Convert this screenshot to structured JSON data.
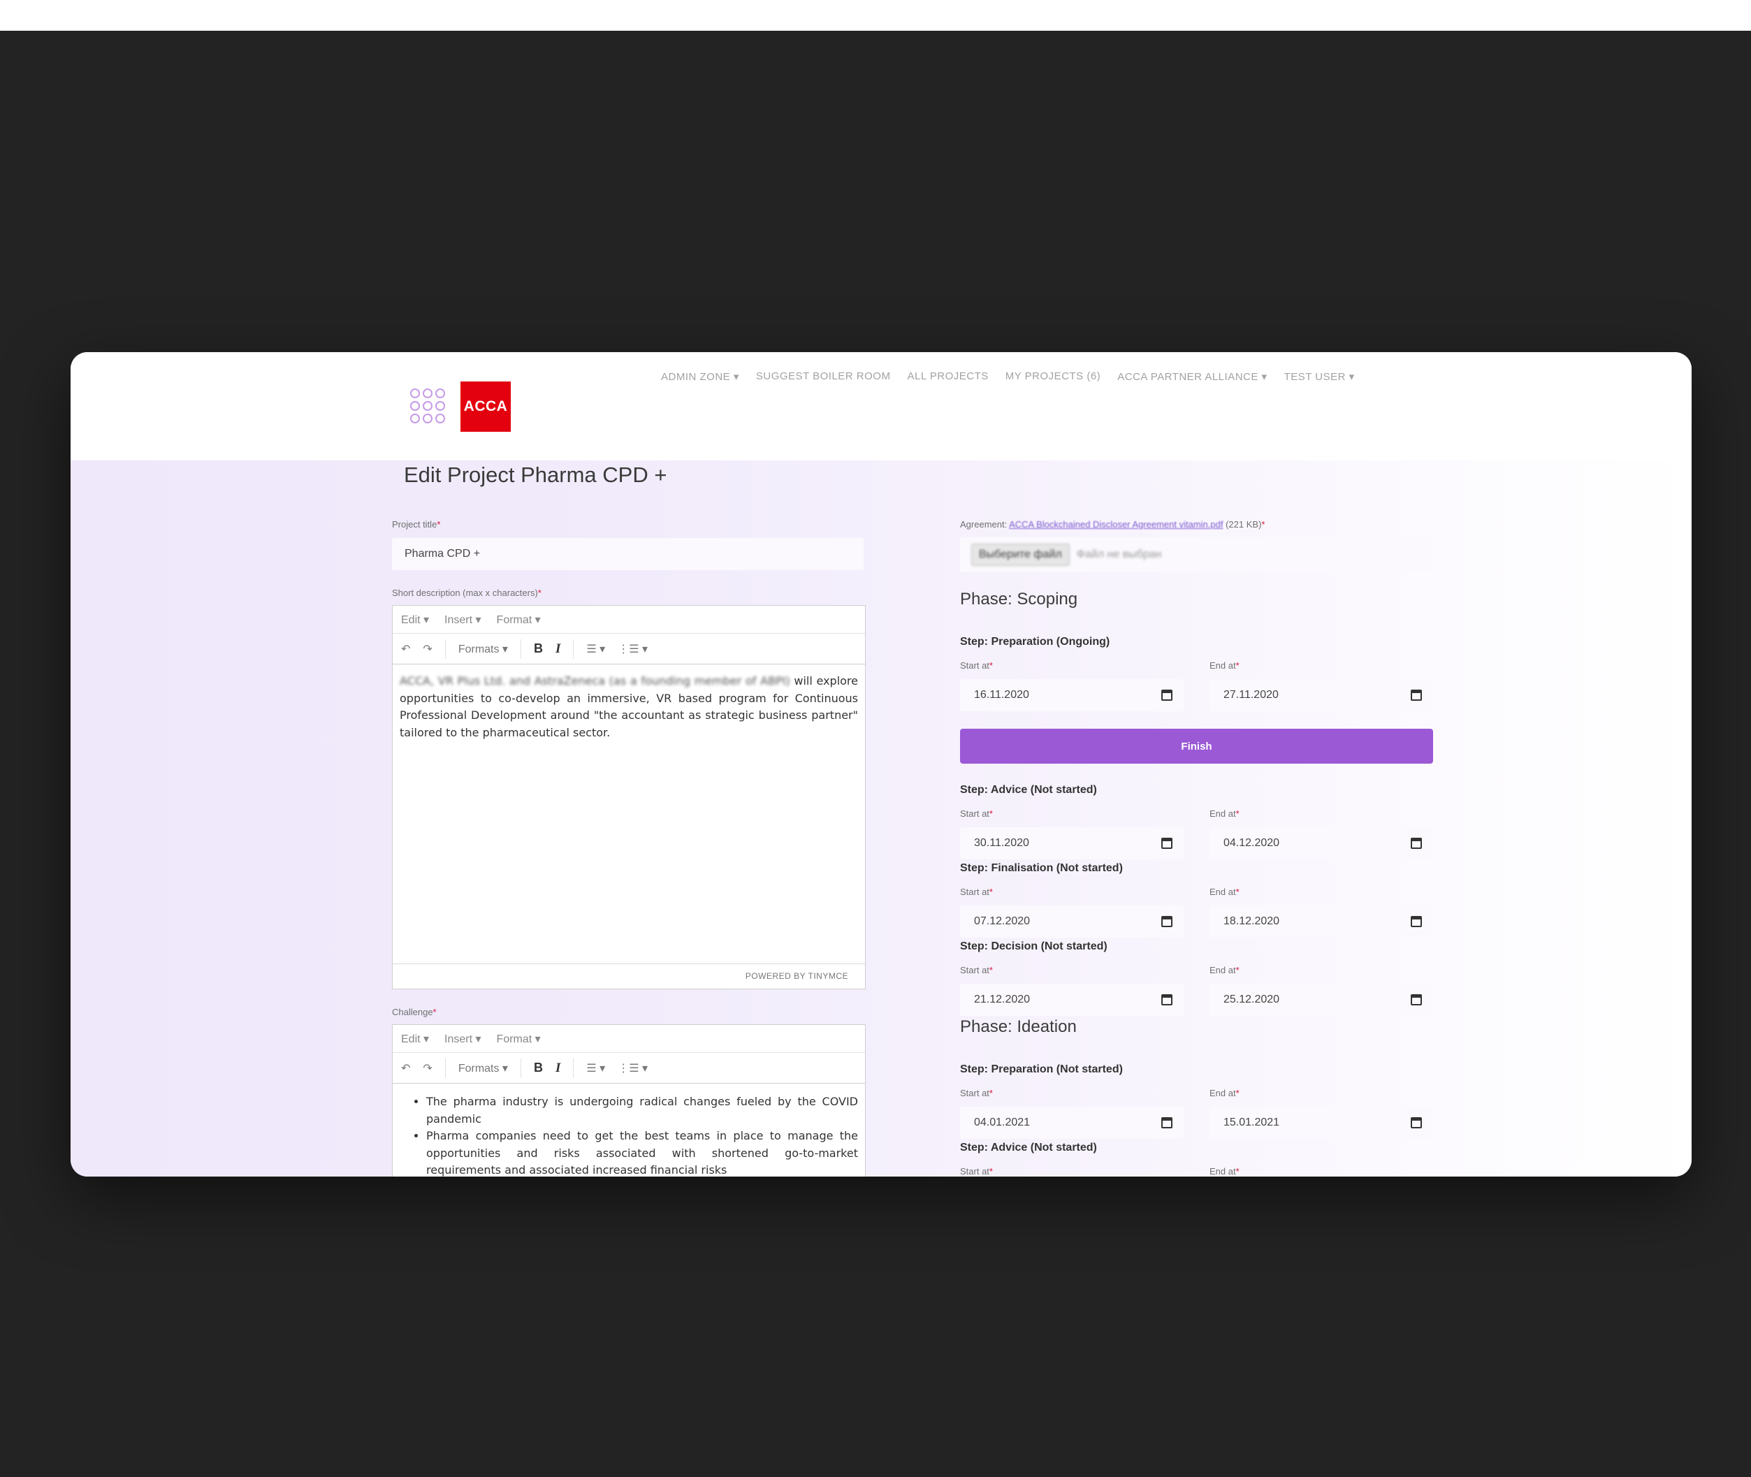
{
  "nav": {
    "items": [
      "ADMIN ZONE ▾",
      "SUGGEST BOILER ROOM",
      "ALL PROJECTS",
      "MY PROJECTS (6)",
      "ACCA PARTNER ALLIANCE ▾",
      "TEST USER ▾"
    ]
  },
  "logo": {
    "text": "ACCA"
  },
  "page": {
    "title": "Edit Project Pharma CPD +"
  },
  "form": {
    "project_title_label": "Project title",
    "project_title_value": "Pharma CPD +",
    "short_desc_label": "Short description (max x characters)",
    "short_desc_blurred": "ACCA, VR Plus Ltd. and AstraZeneca (as a founding member of ABPI)",
    "short_desc_rest": " will explore opportunities to co-develop an immersive, VR based program for Continuous Professional Development around \"the accountant as strategic business partner\" tailored to the pharmaceutical sector.",
    "editor_powered": "POWERED BY TINYMCE",
    "challenge_label": "Challenge",
    "challenge_items": [
      "The pharma industry is undergoing radical changes fueled by the COVID pandemic",
      "Pharma companies need to get the best teams in place to manage the opportunities and risks associated with shortened go-to-market requirements and associated increased financial risks"
    ]
  },
  "editor": {
    "menu": [
      "Edit ▾",
      "Insert ▾",
      "Format ▾"
    ],
    "formats": "Formats ▾",
    "bold": "B",
    "italic": "I"
  },
  "agreement": {
    "label": "Agreement: ",
    "link": "ACCA Blockchained Discloser Agreement vitamin.pdf",
    "size": " (221 KB)",
    "choose_btn": "Выберите файл",
    "no_file": "Файл не выбран"
  },
  "labels": {
    "start": "Start at",
    "end": "End at",
    "finish": "Finish"
  },
  "phases": {
    "scoping": "Phase: Scoping",
    "ideation": "Phase: Ideation"
  },
  "steps": [
    {
      "title": "Step: Preparation (Ongoing)",
      "start": "16.11.2020",
      "end": "27.11.2020"
    },
    {
      "title": "Step: Advice (Not started)",
      "start": "30.11.2020",
      "end": "04.12.2020"
    },
    {
      "title": "Step: Finalisation (Not started)",
      "start": "07.12.2020",
      "end": "18.12.2020"
    },
    {
      "title": "Step: Decision (Not started)",
      "start": "21.12.2020",
      "end": "25.12.2020"
    },
    {
      "title": "Step: Preparation (Not started)",
      "start": "04.01.2021",
      "end": "15.01.2021"
    },
    {
      "title": "Step: Advice (Not started)"
    }
  ],
  "colors": {
    "accent": "#9b59d6",
    "acca_red": "#e3000f",
    "backdrop": "#232323"
  }
}
